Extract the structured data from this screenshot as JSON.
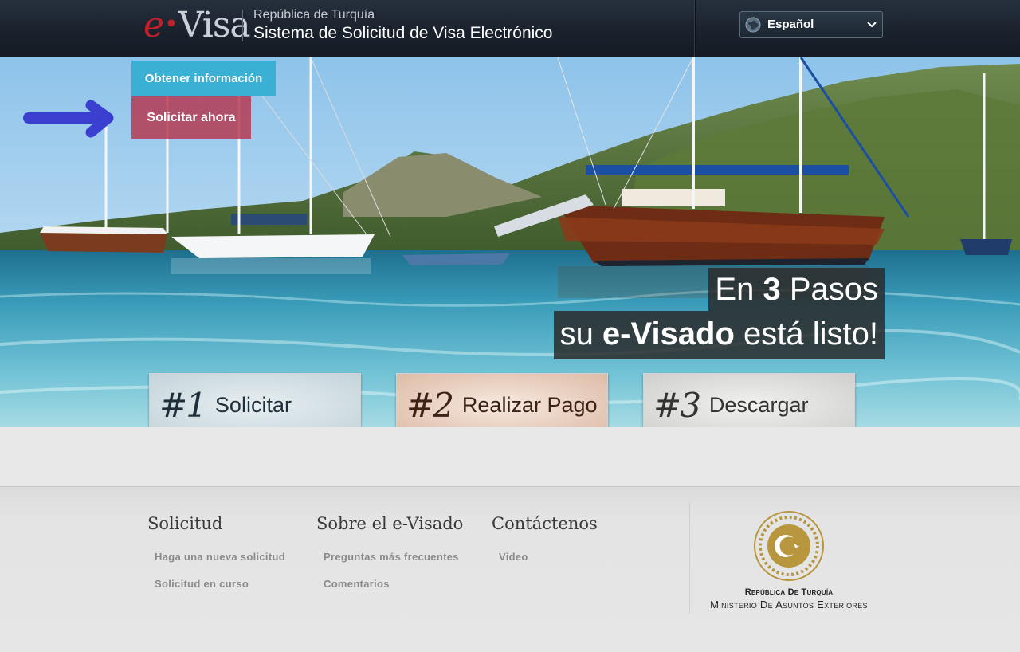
{
  "header": {
    "logo_prefix": "e",
    "logo_suffix": "Visa",
    "country": "República de Turquía",
    "title": "Sistema de Solicitud de Visa Electrónico",
    "language": "Español"
  },
  "nav": {
    "info_label": "Obtener información",
    "apply_label": "Solicitar ahora"
  },
  "hero": {
    "line1_pre": "En ",
    "line1_bold": "3",
    "line1_post": " Pasos",
    "line2_pre": "su ",
    "line2_bold": "e-Visado",
    "line2_post": " está listo!"
  },
  "steps": [
    {
      "num": "#1",
      "label": "Solicitar"
    },
    {
      "num": "#2",
      "label": "Realizar Pago"
    },
    {
      "num": "#3",
      "label": "Descargar"
    }
  ],
  "footer": {
    "columns": [
      {
        "title": "Solicitud",
        "links": [
          "Haga una nueva solicitud",
          "Solicitud en curso"
        ]
      },
      {
        "title": "Sobre el e-Visado",
        "links": [
          "Preguntas más frecuentes",
          "Comentarios"
        ]
      },
      {
        "title": "Contáctenos",
        "links": [
          "Video"
        ]
      }
    ],
    "republic": "República De Turquía",
    "ministry": "Ministerio De Asuntos Exteriores"
  },
  "colors": {
    "header_bg": "#1a222d",
    "info_tab": "#3ab0d4",
    "apply_tab": "#b5344c",
    "arrow": "#3a3fd0",
    "logo_red": "#c41f2b",
    "seal_gold": "#b8963e"
  },
  "icons": {
    "language": "globe-icon",
    "dropdown": "chevron-down-icon",
    "pointer": "arrow-right-icon",
    "emblem": "turkish-seal-icon"
  }
}
